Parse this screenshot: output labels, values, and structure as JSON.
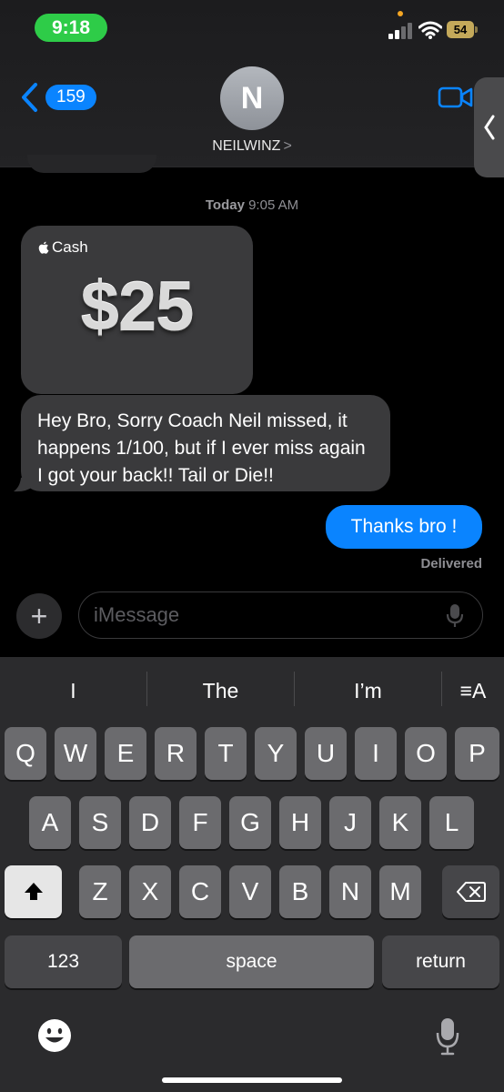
{
  "status_bar": {
    "time": "9:18",
    "battery": "54"
  },
  "header": {
    "back_count": "159",
    "avatar_initial": "N",
    "contact_name": "NEILWINZ",
    "contact_chevron": ">"
  },
  "chat": {
    "timestamp_day": "Today",
    "timestamp_time": "9:05 AM",
    "cash_brand": "Cash",
    "cash_amount": "$25",
    "incoming_message": "Hey Bro, Sorry Coach Neil missed, it happens 1/100, but if I ever miss again I got your back!! Tail or Die!!",
    "outgoing_message": "Thanks bro !",
    "delivered_label": "Delivered"
  },
  "input": {
    "placeholder": "iMessage",
    "plus_label": "+"
  },
  "keyboard": {
    "suggestions": [
      "I",
      "The",
      "I’m"
    ],
    "format_label": "≡A",
    "row1": [
      "Q",
      "W",
      "E",
      "R",
      "T",
      "Y",
      "U",
      "I",
      "O",
      "P"
    ],
    "row2": [
      "A",
      "S",
      "D",
      "F",
      "G",
      "H",
      "J",
      "K",
      "L"
    ],
    "row3": [
      "Z",
      "X",
      "C",
      "V",
      "B",
      "N",
      "M"
    ],
    "numbers_label": "123",
    "space_label": "space",
    "return_label": "return"
  },
  "colors": {
    "accent": "#0a84ff",
    "time_pill": "#2ecc48",
    "bubble_gray": "#3a3a3c"
  },
  "icons": [
    "signal-icon",
    "wifi-icon",
    "battery-icon",
    "back-chevron-icon",
    "video-call-icon",
    "side-tab-chevron-icon",
    "apple-logo-icon",
    "microphone-icon",
    "shift-icon",
    "backspace-icon",
    "emoji-icon",
    "dictation-icon"
  ]
}
